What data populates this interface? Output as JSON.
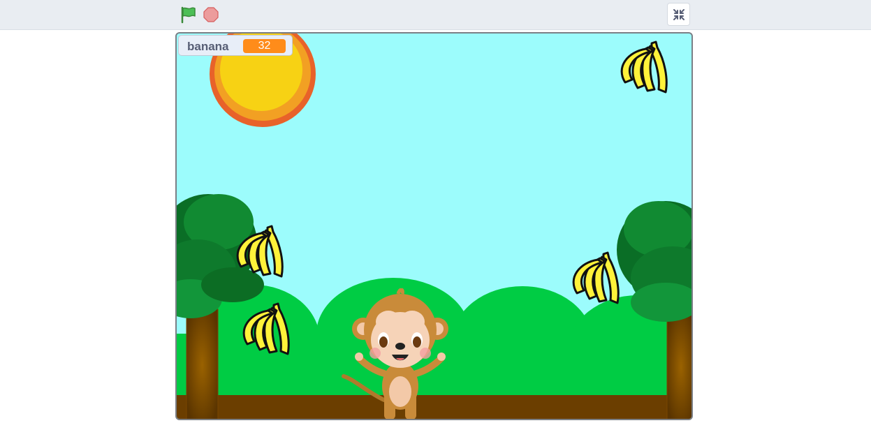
{
  "toolbar": {
    "green_flag": "green-flag-icon",
    "stop": "stop-icon",
    "fullscreen": "exit-fullscreen-icon"
  },
  "monitor": {
    "label": "banana",
    "value": "32"
  },
  "colors": {
    "sky": "#9cfcfc",
    "grass": "#00cc44",
    "ground": "#6b3e00",
    "monitor_value_bg": "#ff8c1a"
  }
}
